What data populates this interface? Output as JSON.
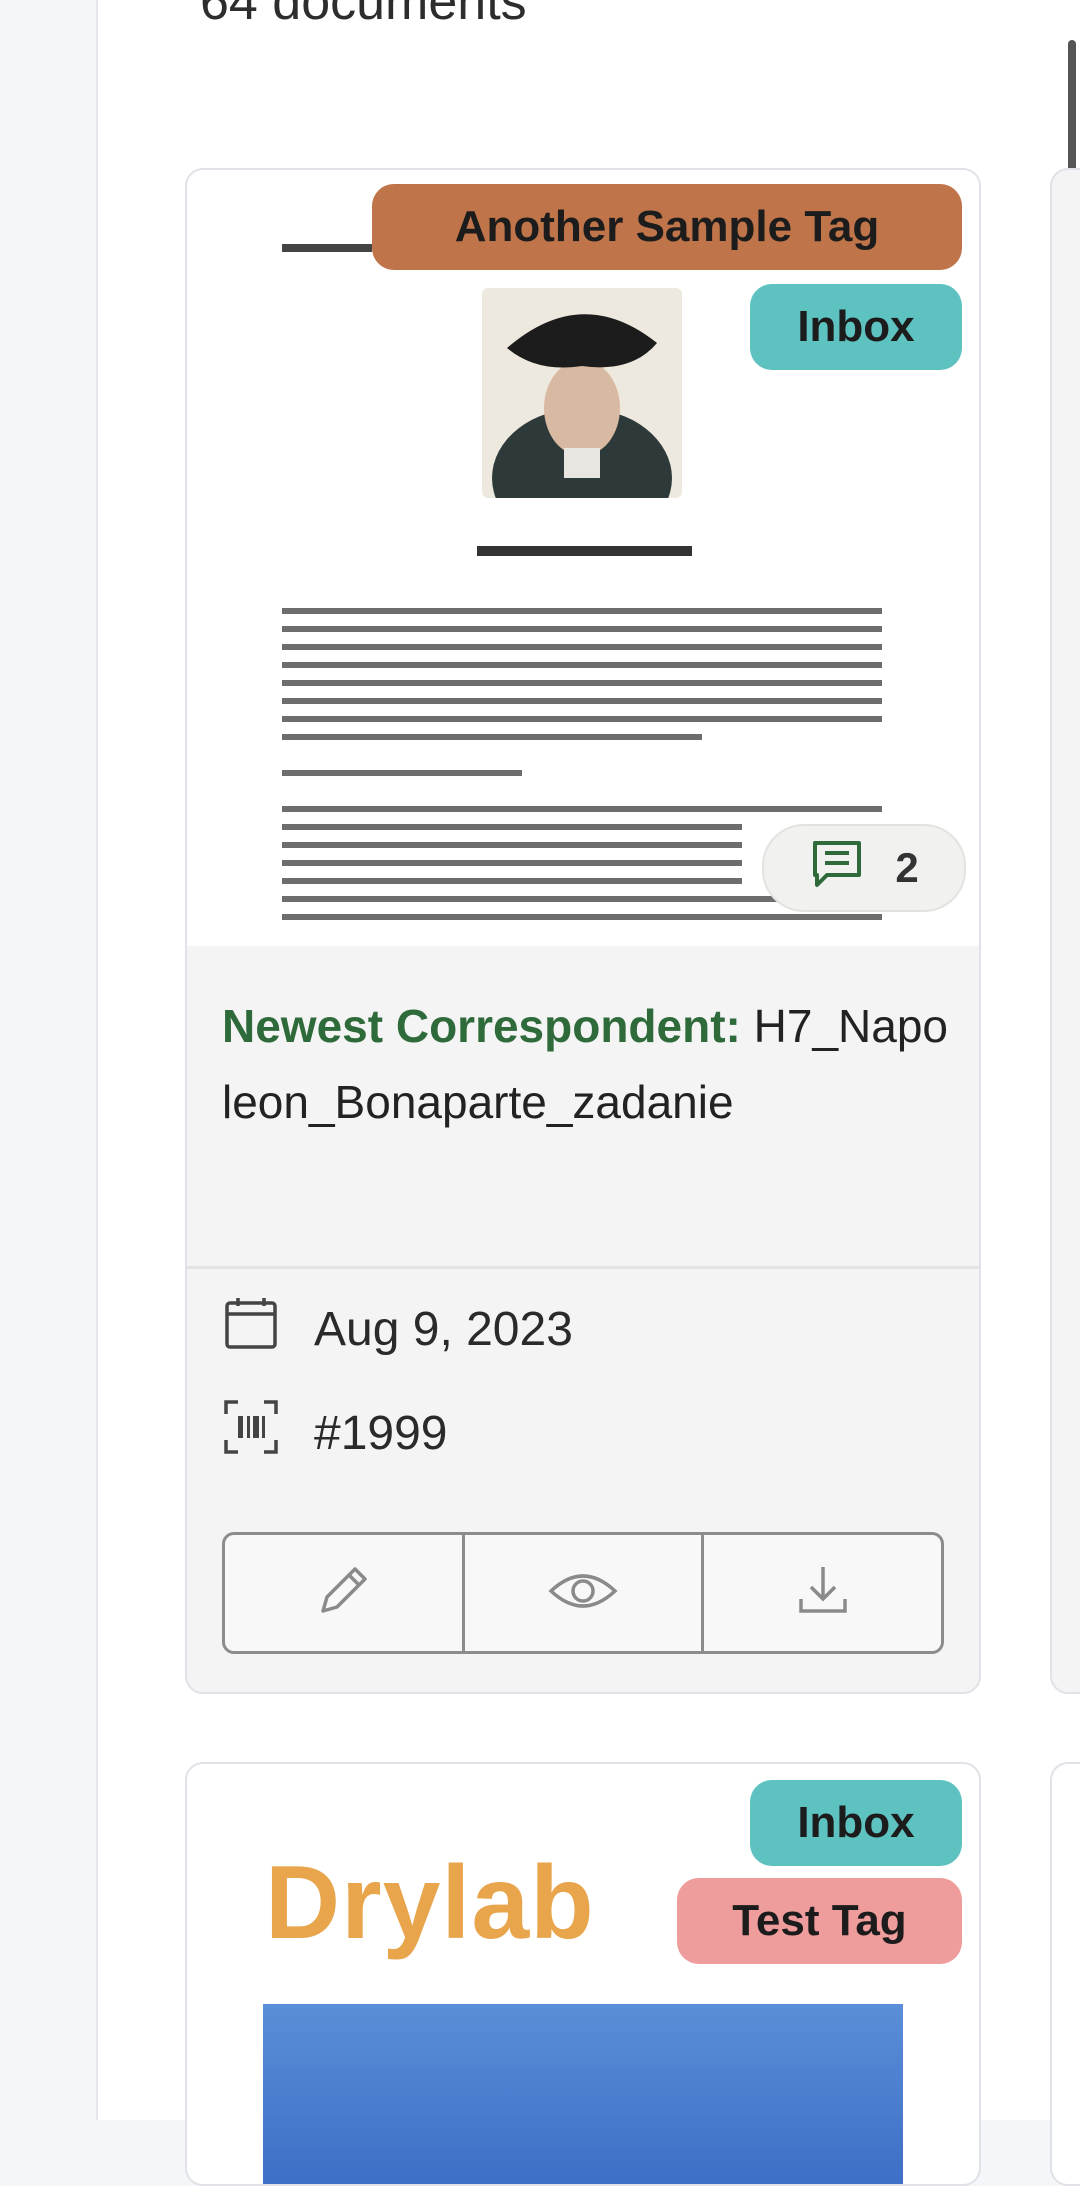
{
  "header": {
    "document_count": "64 documents"
  },
  "cards": [
    {
      "tags": [
        "Another Sample Tag",
        "Inbox"
      ],
      "notes_count": "2",
      "correspondent_label": "Newest Correspondent",
      "title": "H7_Napoleon_Bonaparte_zadanie",
      "created_date": "Aug 9, 2023",
      "asn": "#1999",
      "actions": [
        "edit-icon",
        "preview-icon",
        "download-icon"
      ]
    },
    {
      "tags": [
        "Inbox",
        "Test Tag"
      ],
      "thumbnail_text": "Drylab"
    }
  ],
  "colors": {
    "tag_another_sample": "#c0744a",
    "tag_inbox": "#5ec2c1",
    "tag_test": "#ee9c9c",
    "correspondent": "#2f6b3a"
  }
}
